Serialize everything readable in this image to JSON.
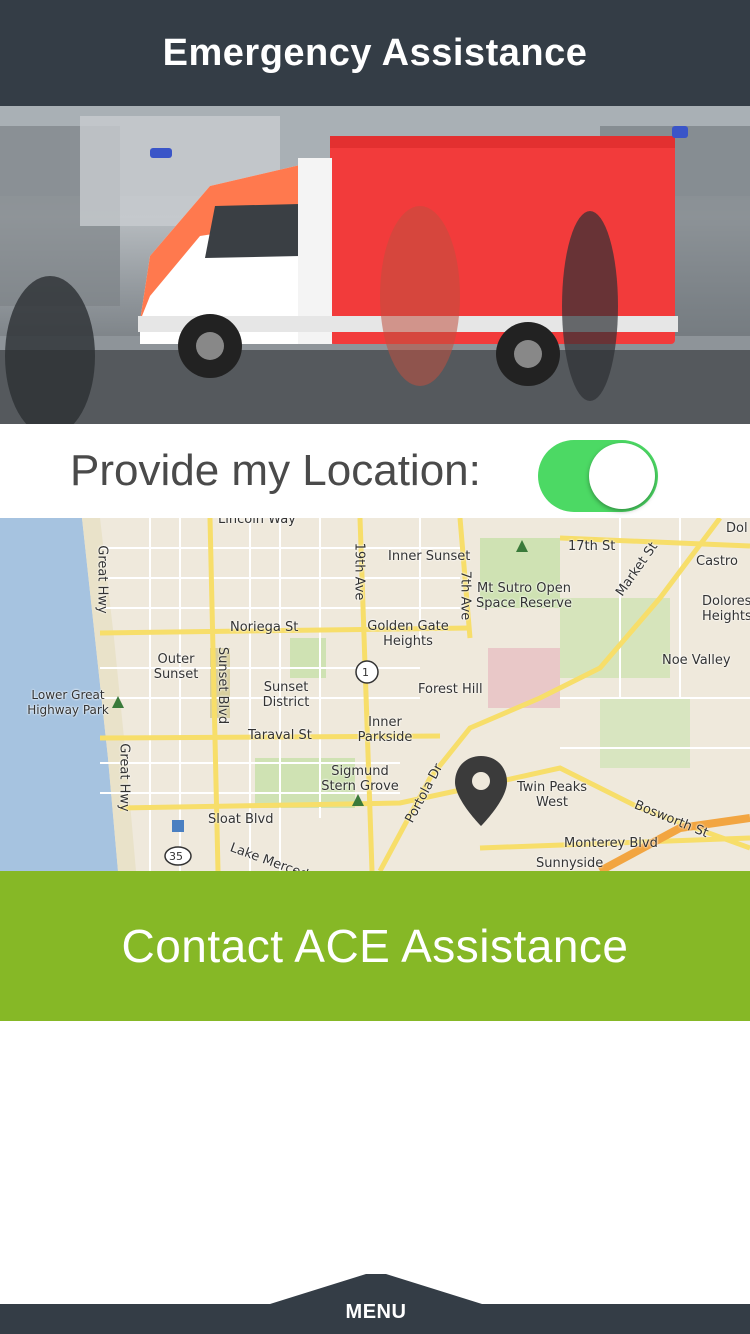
{
  "header": {
    "title": "Emergency Assistance"
  },
  "hero": {
    "image": "ambulance-photo"
  },
  "location": {
    "label": "Provide my Location:",
    "toggle_on": true,
    "toggle_color": "#4cd964"
  },
  "map": {
    "labels": {
      "lincoln_way": "Lincoln Way",
      "inner_sunset": "Inner Sunset",
      "st_17th": "17th St",
      "castro": "Castro",
      "dolores_heights": "Dolores Heights",
      "dol": "Dol",
      "market_st": "Market St",
      "mt_sutro": "Mt Sutro Open Space Reserve",
      "noriega": "Noriega St",
      "golden_gate_heights": "Golden Gate Heights",
      "noe_valley": "Noe Valley",
      "outer_sunset": "Outer Sunset",
      "sunset_district": "Sunset District",
      "forest_hill": "Forest Hill",
      "lower_great_highway_park": "Lower Great Highway Park",
      "taraval": "Taraval St",
      "inner_parkside": "Inner Parkside",
      "sigmund_stern": "Sigmund Stern Grove",
      "twin_peaks_west": "Twin Peaks West",
      "sloat": "Sloat Blvd",
      "bosworth": "Bosworth St",
      "monterey": "Monterey Blvd",
      "sunnyside": "Sunnyside",
      "lake_merced": "Lake Merced",
      "great_hwy": "Great Hwy",
      "sunset_blvd": "Sunset Blvd",
      "ave_19th": "19th Ave",
      "ave_7th": "7th Ave",
      "portola": "Portola Dr",
      "route_1": "1",
      "route_35": "35"
    },
    "pin_icon": "location-pin-icon"
  },
  "contact": {
    "label": "Contact ACE Assistance",
    "color": "#86b826"
  },
  "menu": {
    "label": "MENU",
    "icon": "chevron-up-icon"
  },
  "colors": {
    "header": "#343d46",
    "map_water": "#a6c3e0",
    "map_road": "#f7de6a"
  }
}
